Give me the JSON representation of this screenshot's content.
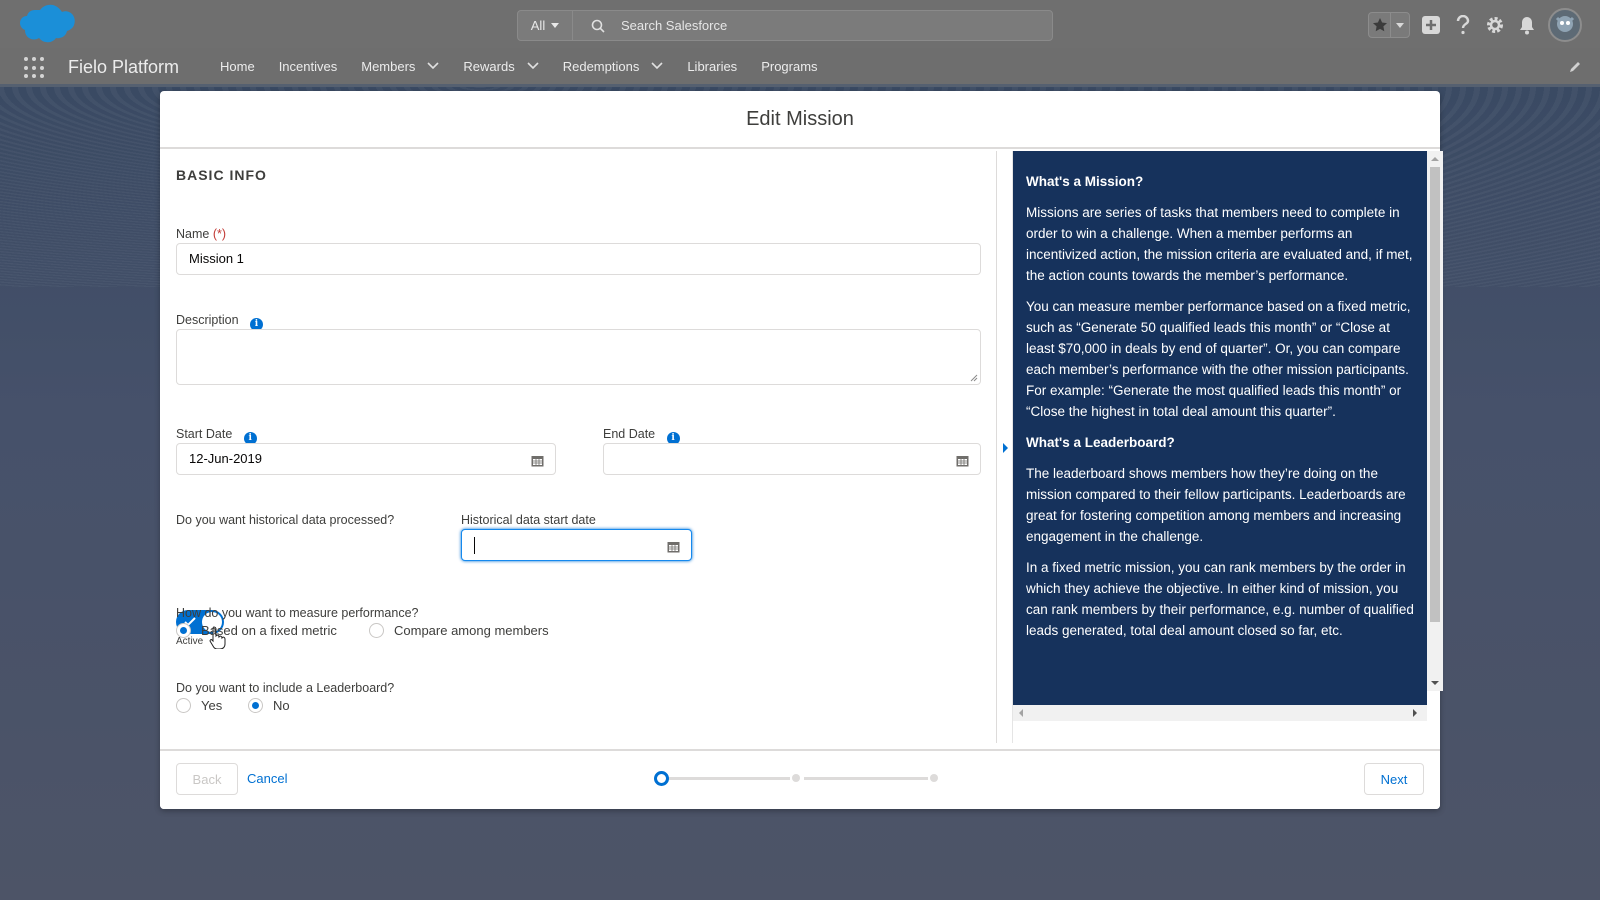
{
  "header": {
    "search_scope": "All",
    "search_placeholder": "Search Salesforce"
  },
  "nav": {
    "app_name": "Fielo Platform",
    "items": [
      {
        "label": "Home",
        "has_menu": false
      },
      {
        "label": "Incentives",
        "has_menu": false
      },
      {
        "label": "Members",
        "has_menu": true
      },
      {
        "label": "Rewards",
        "has_menu": true
      },
      {
        "label": "Redemptions",
        "has_menu": true
      },
      {
        "label": "Libraries",
        "has_menu": false
      },
      {
        "label": "Programs",
        "has_menu": false
      }
    ]
  },
  "modal": {
    "title": "Edit Mission",
    "section_title": "BASIC INFO",
    "name": {
      "label": "Name",
      "required_marker": "(*)",
      "value": "Mission 1"
    },
    "description": {
      "label": "Description",
      "value": ""
    },
    "start_date": {
      "label": "Start Date",
      "value": "12-Jun-2019"
    },
    "end_date": {
      "label": "End Date",
      "value": ""
    },
    "historical": {
      "label": "Do you want historical data processed?",
      "toggle_on": true,
      "toggle_status": "Active"
    },
    "historical_start": {
      "label": "Historical data start date",
      "value": ""
    },
    "measure": {
      "label": "How do you want to measure performance?",
      "options": [
        {
          "label": "Based on a fixed metric",
          "checked": true
        },
        {
          "label": "Compare among members",
          "checked": false
        }
      ]
    },
    "leaderboard": {
      "label": "Do you want to include a Leaderboard?",
      "options": [
        {
          "label": "Yes",
          "checked": false
        },
        {
          "label": "No",
          "checked": true
        }
      ]
    },
    "help": {
      "h1": "What's a Mission?",
      "p1": "Missions are series of tasks that members need to complete in order to win a challenge. When a member performs an incentivized action, the mission criteria are evaluated and, if met, the action counts towards the member’s performance.",
      "p2": "You can measure member performance based on a fixed metric, such as “Generate 50 qualified leads this month” or “Close at least $70,000 in deals by end of quarter”. Or, you can compare each member’s performance with the other mission participants. For example: “Generate the most qualified leads this month” or “Close the highest in total deal amount this quarter”.",
      "h2": "What's a Leaderboard?",
      "p3": "The leaderboard shows members how they’re doing on the mission compared to their fellow participants. Leaderboards are great for fostering competition among members and increasing engagement in the challenge.",
      "p4": "In a fixed metric mission, you can rank members by the order in which they achieve the objective. In either kind of mission, you can rank members by their performance, e.g. number of qualified leads generated, total deal amount closed so far, etc."
    },
    "footer": {
      "back_label": "Back",
      "cancel_label": "Cancel",
      "next_label": "Next",
      "current_step": 1,
      "total_steps": 3
    }
  },
  "colors": {
    "brand": "#0070d2",
    "help_panel_bg": "#16325c",
    "header_bg": "#6f6f6f"
  }
}
